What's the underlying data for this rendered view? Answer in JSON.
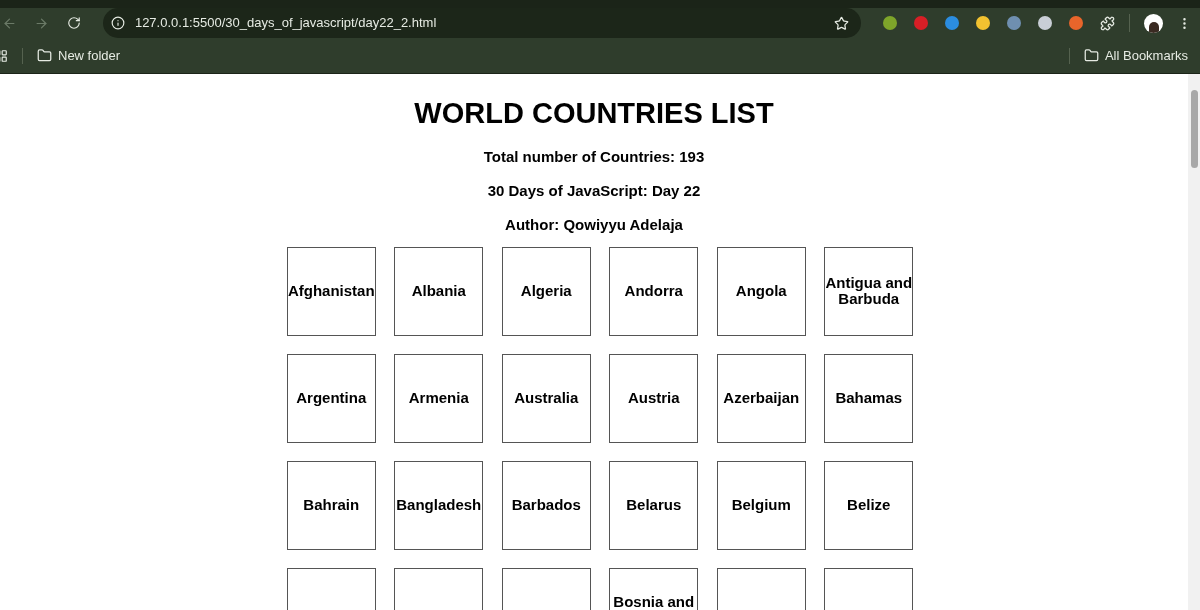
{
  "browser": {
    "url": "127.0.0.1:5500/30_days_of_javascript/day22_2.html",
    "bookmarks": [
      {
        "label": "New folder"
      }
    ],
    "all_bookmarks": "All Bookmarks"
  },
  "page": {
    "title": "WORLD COUNTRIES LIST",
    "subtitles": [
      "Total number of Countries: 193",
      "30 Days of JavaScript: Day 22",
      "Author: Qowiyyu Adelaja"
    ],
    "countries": [
      {
        "name": "Afghanistan"
      },
      {
        "name": "Albania"
      },
      {
        "name": "Algeria"
      },
      {
        "name": "Andorra"
      },
      {
        "name": "Angola"
      },
      {
        "name": "Antigua and Barbuda"
      },
      {
        "name": "Argentina"
      },
      {
        "name": "Armenia"
      },
      {
        "name": "Australia"
      },
      {
        "name": "Austria"
      },
      {
        "name": "Azerbaijan"
      },
      {
        "name": "Bahamas"
      },
      {
        "name": "Bahrain"
      },
      {
        "name": "Bangladesh"
      },
      {
        "name": "Barbados"
      },
      {
        "name": "Belarus"
      },
      {
        "name": "Belgium"
      },
      {
        "name": "Belize"
      },
      {
        "kind": "cut"
      },
      {
        "kind": "cut"
      },
      {
        "kind": "cut"
      },
      {
        "kind": "cut",
        "name": "Bosnia and"
      },
      {
        "kind": "cut"
      },
      {
        "kind": "cut"
      }
    ]
  }
}
